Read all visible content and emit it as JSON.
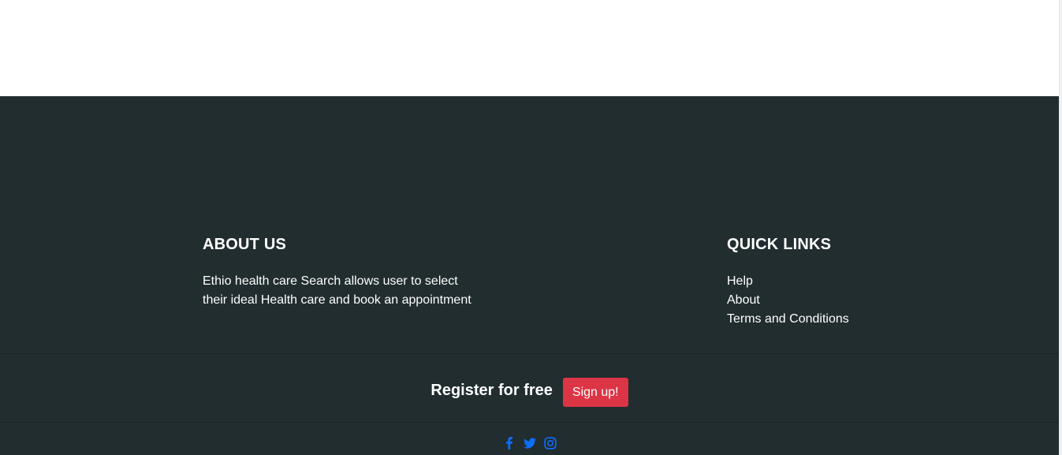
{
  "footer": {
    "about": {
      "heading": "ABOUT US",
      "text": "Ethio health care Search allows user to select their ideal Health care and book an appointment"
    },
    "quick_links": {
      "heading": "QUICK LINKS",
      "items": [
        {
          "label": "Help"
        },
        {
          "label": "About"
        },
        {
          "label": "Terms and Conditions"
        }
      ]
    },
    "register": {
      "text": "Register for free",
      "button_label": "Sign up!"
    },
    "social": [
      "facebook-icon",
      "twitter-icon",
      "instagram-icon"
    ],
    "colors": {
      "background": "#212d2f",
      "accent": "#dc3545",
      "social": "#0d6efd"
    }
  }
}
